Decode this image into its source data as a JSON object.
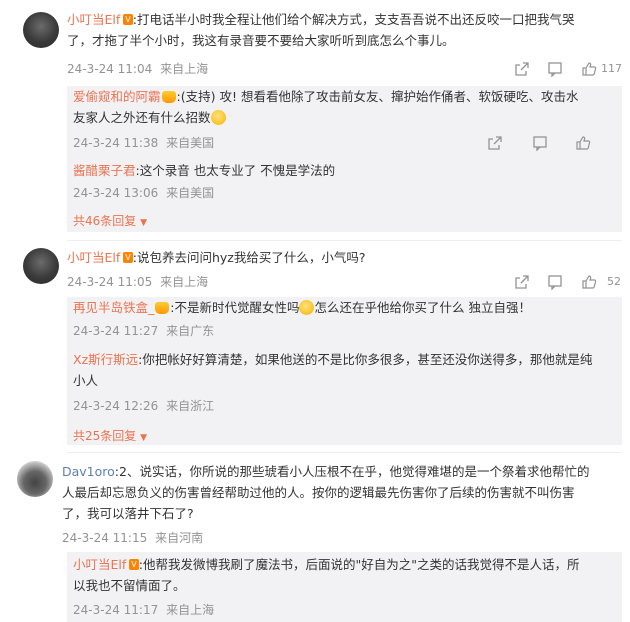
{
  "comments": [
    {
      "user": "小叮当Elf",
      "badge": "V",
      "text1": ":打电话半小时我全程让他们给个解决方式，支支吾吾说不出还反咬一口把我气哭",
      "text2": "了，才拖了半个小时，我这有录音要不要给大家听听到底怎么个事儿。",
      "date": "24-3-24 11:04",
      "location": "来自上海",
      "likes": "117",
      "replies": [
        {
          "user": "爱偷窥和的阿霸",
          "text1": ":(支持) 攻! 想看看他除了攻击前女友、撺护始作俑者、软饭硬吃、攻击水",
          "text2": "友家人之外还有什么招数",
          "date": "24-3-24 11:38",
          "location": "来自美国"
        },
        {
          "user": "酱醋栗子君",
          "text1": ":这个录音 也太专业了 不愧是学法的",
          "date": "24-3-24 13:06",
          "location": "来自美国"
        }
      ],
      "more": "共46条回复"
    },
    {
      "user": "小叮当Elf",
      "badge": "V",
      "text1": ":说包养去问问hyz我给买了什么，小气吗?",
      "date": "24-3-24 11:05",
      "location": "来自上海",
      "likes": "52",
      "replies": [
        {
          "user": "再见半岛铁盒_",
          "text1": ":不是新时代觉醒女性吗",
          "text1b": "怎么还在乎他给你买了什么 独立自强！",
          "date": "24-3-24 11:27",
          "location": "来自广东"
        },
        {
          "user": "Xz斯行斯远",
          "text1": ":你把帐好好算清楚，如果他送的不是比你多很多，甚至还没你送得多，那他就是纯",
          "text2": "小人",
          "date": "24-3-24 12:26",
          "location": "来自浙江"
        }
      ],
      "more": "共25条回复"
    },
    {
      "user": "Dav1oro",
      "text1": ":2、说实话，你所说的那些琥看小人压根不在乎，他觉得难堪的是一个祭着求他帮忙的",
      "text2": "人最后却忘恩负义的伤害曾经帮助过他的人。按你的逻辑最先伤害你了后续的伤害就不叫伤害",
      "text3": "了，我可以落井下石了?",
      "date": "24-3-24 11:15",
      "location": "来自河南",
      "replies": [
        {
          "user": "小叮当Elf",
          "badge": "V",
          "text1": ":他帮我发微博我刷了魔法书，后面说的\"好自为之\"之类的话我觉得不是人话，所",
          "text2": "以我也不留情面了。",
          "date": "24-3-24 11:17",
          "location": "来自上海"
        }
      ]
    }
  ],
  "icons": [
    "share-icon",
    "comment-icon",
    "like-icon"
  ]
}
